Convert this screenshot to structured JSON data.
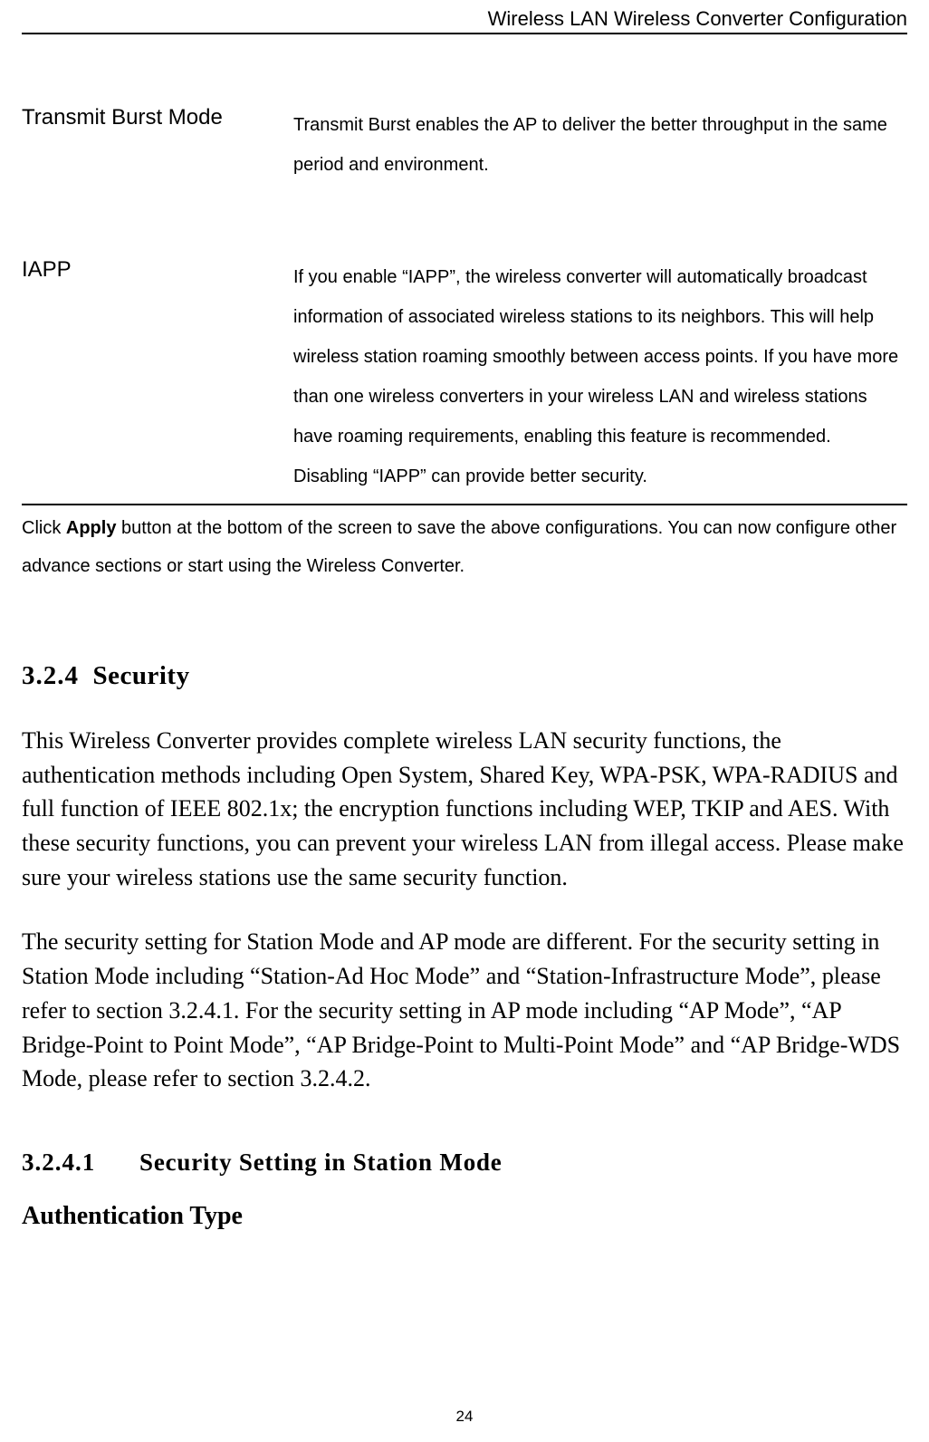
{
  "header": {
    "title": "Wireless LAN Wireless Converter Configuration"
  },
  "definitions": [
    {
      "label": "Transmit Burst Mode",
      "desc": "Transmit Burst enables the AP to deliver the better throughput in the same period and environment."
    },
    {
      "label": "IAPP",
      "desc": "If you enable “IAPP”, the wireless converter will automatically broadcast information of associated wireless stations to its neighbors. This will help wireless station roaming smoothly between access points. If you have more than one wireless converters in your wireless LAN and wireless stations have roaming requirements, enabling this feature is recommended. Disabling “IAPP” can provide better security."
    }
  ],
  "note": {
    "prefix": "Click ",
    "bold": "Apply",
    "suffix": " button at the bottom of the screen to save the above configurations. You can now configure other advance sections or start using the Wireless Converter."
  },
  "section_324": {
    "number": "3.2.4",
    "title": "Security"
  },
  "para1": "This Wireless Converter provides complete wireless LAN security functions, the authentication methods including Open System, Shared Key, WPA-PSK, WPA-RADIUS and full function of IEEE 802.1x; the encryption functions including WEP, TKIP and AES. With these security functions, you can prevent your wireless LAN from illegal access. Please make sure your wireless stations use the same security function.",
  "para2": "The security setting for Station Mode and AP mode are different. For the security setting in Station Mode including “Station-Ad Hoc Mode” and “Station-Infrastructure Mode”, please refer to section 3.2.4.1. For the security setting in AP mode including “AP Mode”, “AP Bridge-Point to Point Mode”, “AP Bridge-Point to Multi-Point Mode” and “AP Bridge-WDS Mode, please refer to section 3.2.4.2.",
  "section_3241": {
    "number": "3.2.4.1",
    "title": "Security Setting in Station Mode"
  },
  "auth_heading": "Authentication Type",
  "footer": {
    "page_number": "24"
  }
}
